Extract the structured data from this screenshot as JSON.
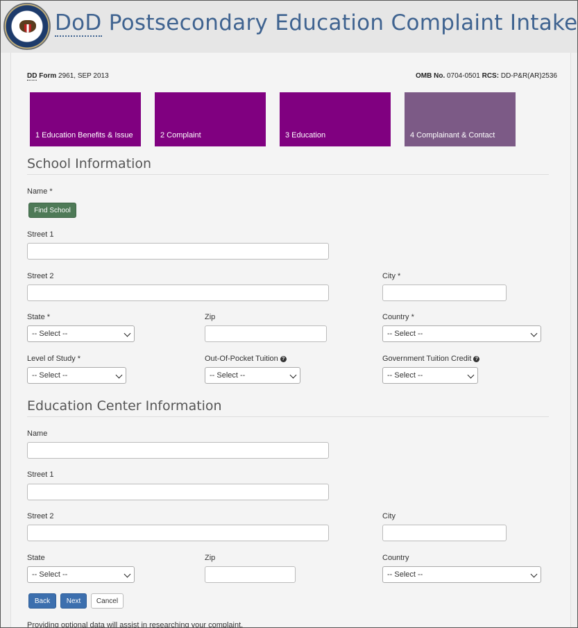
{
  "header": {
    "title_abbr": "DoD",
    "title_rest": " Postsecondary Education Complaint Intake"
  },
  "form_meta": {
    "form_abbr": "DD",
    "form_label": "Form",
    "form_value": "2961, SEP 2013",
    "omb_label": "OMB No.",
    "omb_value": "0704-0501",
    "rcs_label": "RCS:",
    "rcs_value": "DD-P&R(AR)2536"
  },
  "steps": [
    {
      "label": "1 Education Benefits & Issue"
    },
    {
      "label": "2 Complaint"
    },
    {
      "label": "3 Education"
    },
    {
      "label": "4 Complainant & Contact"
    }
  ],
  "school": {
    "section_title": "School Information",
    "name_label": "Name *",
    "find_school_label": "Find School",
    "street1_label": "Street 1",
    "street2_label": "Street 2",
    "city_label": "City *",
    "state_label": "State *",
    "state_value": "-- Select --",
    "zip_label": "Zip",
    "country_label": "Country *",
    "country_value": "-- Select --",
    "level_label": "Level of Study *",
    "level_value": "-- Select --",
    "oop_label": "Out-Of-Pocket Tuition",
    "oop_value": "-- Select --",
    "gov_label": "Government Tuition Credit",
    "gov_value": "-- Select --",
    "help_glyph": "?"
  },
  "center": {
    "section_title": "Education Center Information",
    "name_label": "Name",
    "street1_label": "Street 1",
    "street2_label": "Street 2",
    "city_label": "City",
    "state_label": "State",
    "state_value": "-- Select --",
    "zip_label": "Zip",
    "country_label": "Country",
    "country_value": "-- Select --"
  },
  "buttons": {
    "back": "Back",
    "next": "Next",
    "cancel": "Cancel"
  },
  "footnote": "Providing optional data will assist in researching your complaint."
}
